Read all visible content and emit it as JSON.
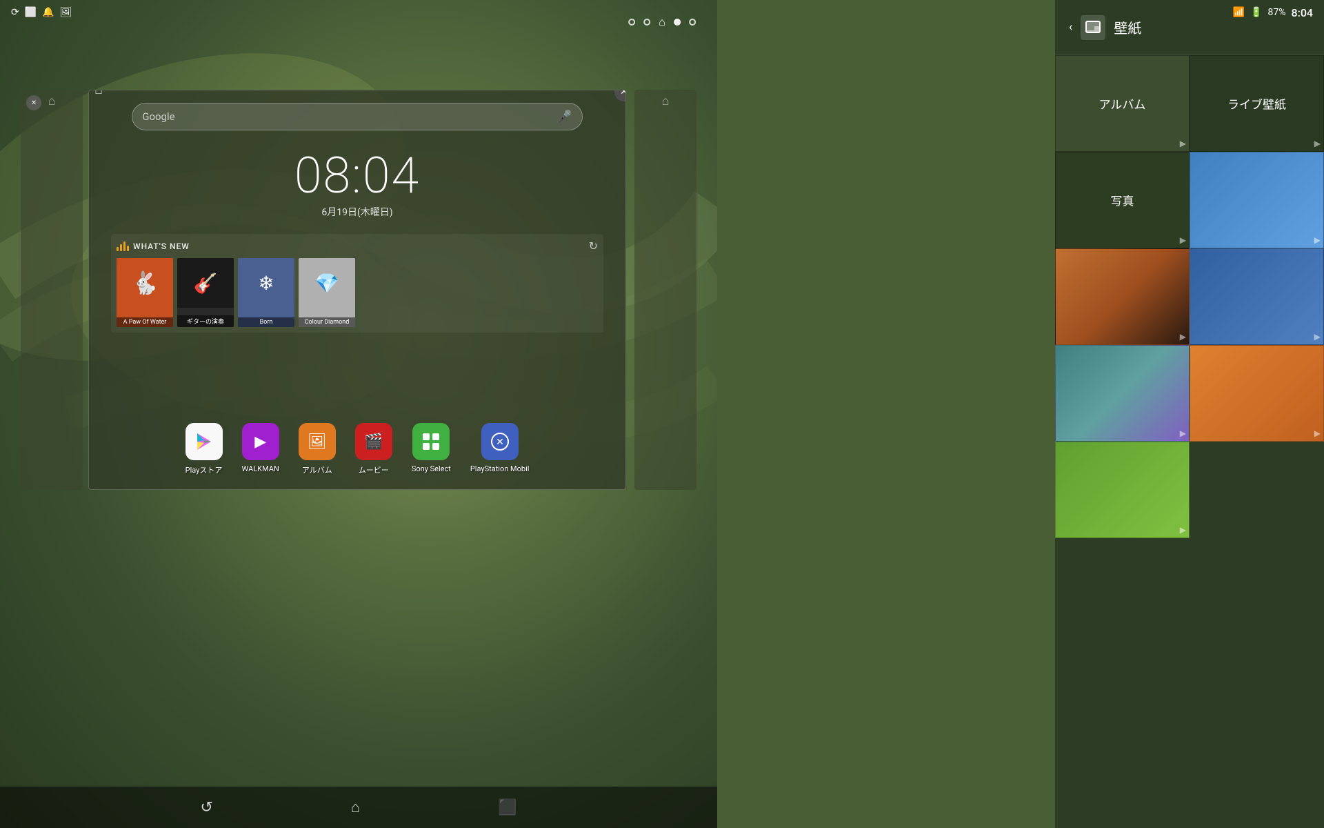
{
  "statusBar": {
    "time": "8:04",
    "battery": "87%",
    "icons": [
      "screen-rotation",
      "screenshot",
      "notification",
      "photo"
    ]
  },
  "navDots": {
    "dots": [
      "dot1",
      "dot2",
      "home",
      "dot4",
      "dot5"
    ],
    "activeIndex": 2
  },
  "homePreview": {
    "closeLabel": "×",
    "searchPlaceholder": "Google",
    "time": "08:04",
    "date": "6月19日(木曜日)",
    "whatsNew": {
      "title": "WHAT'S NEW",
      "refreshLabel": "↻",
      "cards": [
        {
          "title": "A Paw Of Water",
          "emoji": "🐰",
          "bg": "#c85020"
        },
        {
          "title": "ギターの演奏",
          "emoji": "🎸",
          "bg": "#1a1a1a"
        },
        {
          "title": "Born",
          "emoji": "❄",
          "bg": "#4a6090"
        },
        {
          "title": "Colour Diamond",
          "emoji": "💎",
          "bg": "#a0a0a0"
        }
      ]
    },
    "apps": [
      {
        "name": "Playストア",
        "icon": "🛍",
        "bg": "#f0f0f0",
        "color": "#000"
      },
      {
        "name": "WALKMAN",
        "icon": "▶",
        "bg": "#a020d0",
        "color": "#fff"
      },
      {
        "name": "アルバム",
        "icon": "🖼",
        "bg": "#e07820",
        "color": "#fff"
      },
      {
        "name": "ムービー",
        "icon": "🎬",
        "bg": "#cc2020",
        "color": "#fff"
      },
      {
        "name": "Sony Select",
        "icon": "⊞",
        "bg": "#40b040",
        "color": "#fff"
      },
      {
        "name": "PlayStation Mobil",
        "icon": "✕",
        "bg": "#4060c0",
        "color": "#fff"
      }
    ]
  },
  "wallpaperPanel": {
    "backLabel": "‹",
    "title": "壁紙",
    "iconLabel": "🖼",
    "categories": [
      {
        "label": "アルバム",
        "type": "album"
      },
      {
        "label": "ライブ壁紙",
        "type": "live"
      },
      {
        "label": "写真",
        "type": "photo"
      },
      {
        "label": "",
        "type": "water",
        "hasThumb": true
      },
      {
        "label": "",
        "type": "sunset",
        "hasThumb": true
      },
      {
        "label": "",
        "type": "lake",
        "hasThumb": true
      },
      {
        "label": "",
        "type": "teal",
        "hasThumb": true
      },
      {
        "label": "",
        "type": "orange",
        "hasThumb": true
      },
      {
        "label": "",
        "type": "grass",
        "hasThumb": true
      }
    ]
  },
  "navBar": {
    "backLabel": "↺",
    "homeLabel": "⌂",
    "recentLabel": "⬛"
  }
}
